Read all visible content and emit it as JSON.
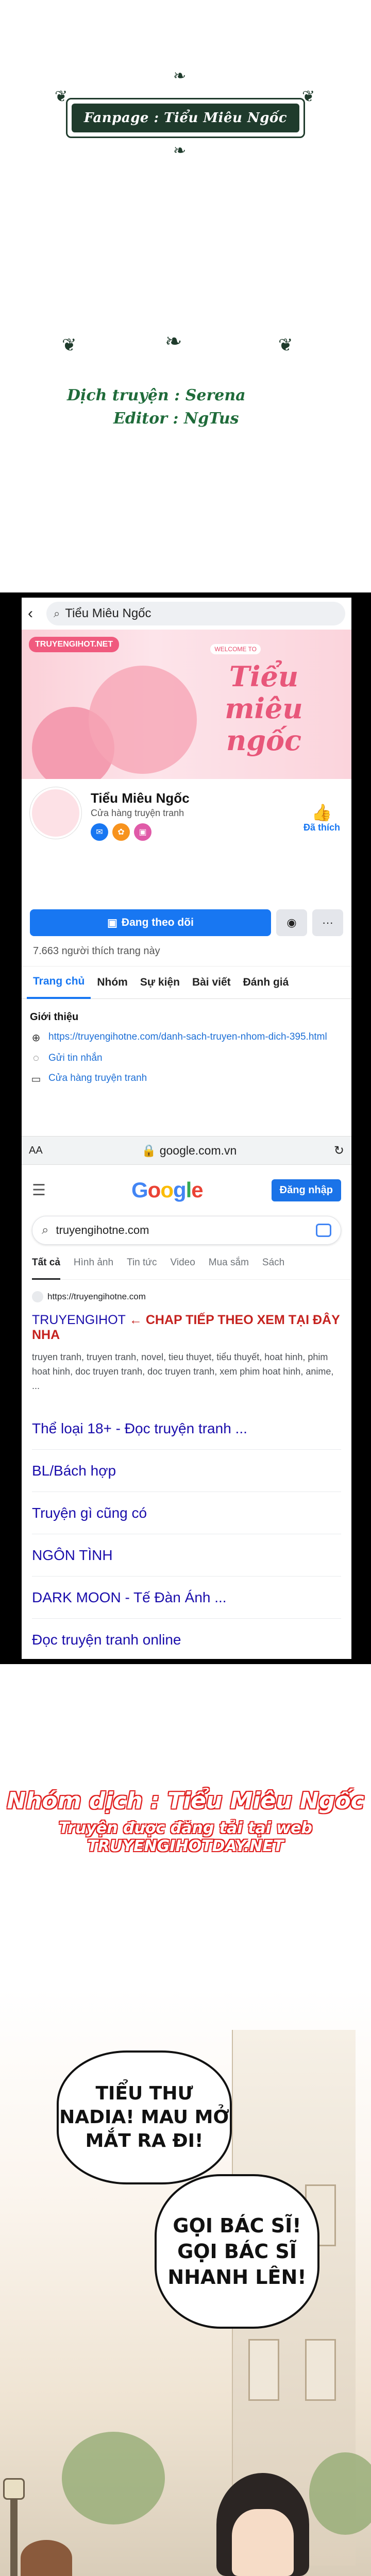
{
  "fanpage": {
    "label": "Fanpage : Tiểu Miêu Ngốc"
  },
  "credits": {
    "translator": "Dịch truyện : Serena",
    "editor": "Editor : NgTus"
  },
  "facebook": {
    "search_text": "Tiểu Miêu Ngốc",
    "cover": {
      "site_badge": "TRUYENGIHOT.NET",
      "welcome": "WELCOME TO",
      "title": "Tiểu miêu ngốc"
    },
    "page_name": "Tiểu Miêu Ngốc",
    "page_category": "Cửa hàng truyện tranh",
    "liked_label": "Đã thích",
    "follow_label": "Đang theo dõi",
    "more_label": "···",
    "likes_count": "7.663 người thích trang này",
    "tabs": [
      "Trang chủ",
      "Nhóm",
      "Sự kiện",
      "Bài viết",
      "Đánh giá"
    ],
    "intro_title": "Giới thiệu",
    "intro_link": "https://truyengihotne.com/danh-sach-truyen-nhom-dich-395.html",
    "intro_message": "Gửi tin nhắn",
    "intro_shop": "Cửa hàng truyện tranh"
  },
  "browser": {
    "aa": "AA",
    "url": "google.com.vn"
  },
  "google": {
    "logo": "Google",
    "signin": "Đăng nhập",
    "query": "truyengihotne.com",
    "tabs": [
      "Tất cả",
      "Hình ảnh",
      "Tin tức",
      "Video",
      "Mua sắm",
      "Sách"
    ],
    "result": {
      "site": "https://truyengihotne.com",
      "title_plain": "TRUYENGIHOT",
      "title_red": " ← CHAP TIẾP THEO XEM TẠI ĐÂY NHA",
      "desc": "truyen tranh, truyen tranh, novel, tieu thuyet, tiểu thuyết, hoat hinh, phim hoat hinh, doc truyen tranh, doc truyen tranh, xem phim hoat hinh, anime, ..."
    },
    "links": [
      "Thể loại 18+ - Đọc truyện tranh ...",
      "BL/Bách hợp",
      "Truyện gì cũng có",
      "NGÔN TÌNH",
      "DARK MOON - Tế Đàn Ánh ...",
      "Đọc truyện tranh online"
    ]
  },
  "group": {
    "name": "Nhóm dịch : Tiểu Miêu Ngốc",
    "web": "Truyện được đăng tải tại web TRUYENGIHOTDAY.NET"
  },
  "comic": {
    "bubble1": "TIỂU THƯ NADIA! MAU MỞ MẮT RA ĐI!",
    "bubble2": "GỌI BÁC SĨ! GỌI BÁC SĨ NHANH LÊN!"
  },
  "colors": {
    "fb_blue": "#1877f2",
    "google_link": "#1a0dab",
    "credit_red": "#e02020",
    "banner_green": "#1f3b2c"
  }
}
